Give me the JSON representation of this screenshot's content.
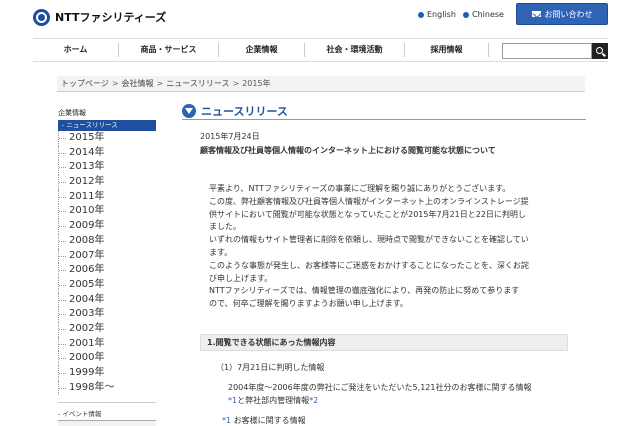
{
  "header": {
    "logo_text": "NTTファシリティーズ",
    "lang_en": "English",
    "lang_zh": "Chinese",
    "contact_label": "お問い合わせ"
  },
  "nav": {
    "items": [
      "ホーム",
      "商品・サービス",
      "企業情報",
      "社会・環境活動",
      "採用情報"
    ]
  },
  "breadcrumb": {
    "items": [
      "トップページ",
      "会社情報",
      "ニュースリリース",
      "2015年"
    ],
    "separator": ">"
  },
  "sidebar": {
    "heading": "企業情報",
    "active_item": "- ニュースリリース",
    "years": [
      "2015年",
      "2014年",
      "2013年",
      "2012年",
      "2011年",
      "2010年",
      "2009年",
      "2008年",
      "2007年",
      "2006年",
      "2005年",
      "2004年",
      "2003年",
      "2002年",
      "2001年",
      "2000年",
      "1999年",
      "1998年～"
    ],
    "event_item": "- イベント情報"
  },
  "main": {
    "section_title": "ニュースリリース",
    "date": "2015年7月24日",
    "headline": "顧客情報及び社員等個人情報のインターネット上における閲覧可能な状態について",
    "body_lines": [
      "平素より、NTTファシリティーズの事業にご理解を賜り誠にありがとうございます。",
      "この度、弊社顧客情報及び社員等個人情報がインターネット上のオンラインストレージ提",
      "供サイトにおいて閲覧が可能な状態となっていたことが2015年7月21日と22日に判明し",
      "ました。",
      "いずれの情報もサイト管理者に削除を依頼し、現時点で閲覧ができないことを確認してい",
      "ます。",
      "このような事態が発生し、お客様等にご迷惑をおかけすることになったことを、深くお詫",
      "び申し上げます。",
      "NTTファシリティーズでは、情報管理の徹底強化により、再発の防止に努めて参ります",
      "ので、何卒ご理解を賜りますようお願い申し上げます。"
    ],
    "subhead": "1.閲覧できる状態にあった情報内容",
    "item1": "（1）7月21日に判明した情報",
    "item1_line1": "2004年度～2006年度の弊社にご発注をいただいた5,121社分のお客様に関する情報",
    "item1_note1": "*1",
    "item1_mid": "と弊社部内管理情報",
    "item1_note2": "*2",
    "footnote_mark": "*1",
    "footnote_text": "お客様に関する情報"
  }
}
